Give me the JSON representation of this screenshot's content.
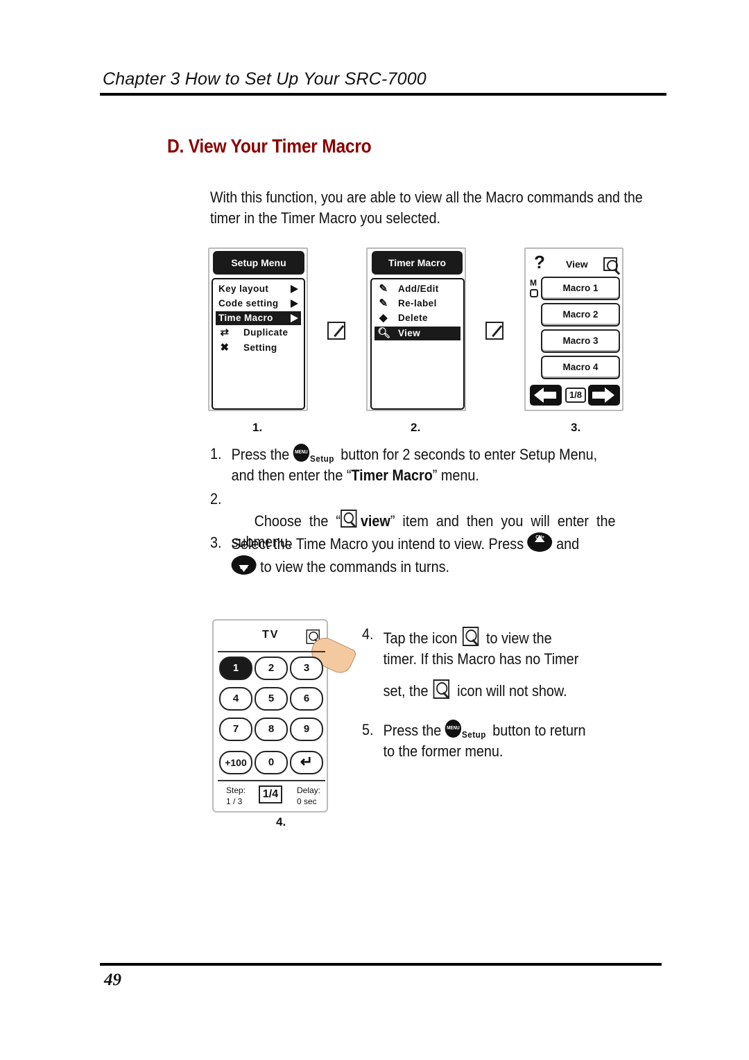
{
  "header": {
    "chapter_title": "Chapter 3  How to Set Up Your SRC-7000"
  },
  "section": {
    "title": "D.  View Your Timer Macro",
    "intro": "With this function, you are able to view all the Macro commands and the timer in the Timer Macro you selected."
  },
  "figures": {
    "setup_menu": {
      "title": "Setup Menu",
      "items": [
        {
          "label": "Key layout",
          "arrow": true
        },
        {
          "label": "Code setting",
          "arrow": true
        },
        {
          "label": "Time  Macro",
          "arrow": true,
          "selected": true
        },
        {
          "label": "Duplicate",
          "icon": "duplicate-icon"
        },
        {
          "label": "Setting",
          "icon": "tools-icon"
        }
      ],
      "caption": "1."
    },
    "timer_macro": {
      "title": "Timer Macro",
      "items": [
        {
          "label": "Add/Edit",
          "icon": "add-edit-icon"
        },
        {
          "label": "Re-label",
          "icon": "relabel-icon"
        },
        {
          "label": "Delete",
          "icon": "delete-icon"
        },
        {
          "label": "View",
          "icon": "view-icon",
          "selected": true
        }
      ],
      "caption": "2."
    },
    "view_screen": {
      "help": "?",
      "title": "View",
      "side_label": "M",
      "macros": [
        "Macro 1",
        "Macro 2",
        "Macro 3",
        "Macro 4"
      ],
      "page": "1/8",
      "caption": "3."
    },
    "keypad_screen": {
      "device": "TV",
      "keys": [
        "1",
        "2",
        "3",
        "4",
        "5",
        "6",
        "7",
        "8",
        "9",
        "+100",
        "0",
        "enter"
      ],
      "selected_key": "1",
      "step_label": "Step:",
      "step_value": "1 / 3",
      "page": "1/4",
      "delay_label": "Delay:",
      "delay_value": "0 sec",
      "caption": "4."
    }
  },
  "menu_button": {
    "circle_text": "MENU",
    "label": "Setup"
  },
  "ch_up": {
    "text": "CH+"
  },
  "ch_down": {
    "text": "CH-"
  },
  "steps": {
    "s1": {
      "num": "1.",
      "a": "Press the",
      "b": "button for 2 seconds to enter Setup Menu,",
      "c": "and then enter the “",
      "bold": "Timer Macro",
      "d": "” menu."
    },
    "s2": {
      "num": "2.",
      "a": "Choose  the  “",
      "bold": "view",
      "b": "”  item  and  then  you  will  enter  the",
      "c": "submenu."
    },
    "s3": {
      "num": "3.",
      "a": "Select the Time Macro you intend to view. Press",
      "b": "and",
      "c": "to view the commands in turns."
    },
    "s4": {
      "num": "4.",
      "a": "Tap  the  icon",
      "b": "to  view  the",
      "c": "timer. If this Macro has no Timer",
      "d": "set, the",
      "e": "icon will not show."
    },
    "s5": {
      "num": "5.",
      "a": "Press the",
      "b": "button to return",
      "c": "to the former menu."
    }
  },
  "footer": {
    "page_number": "49"
  }
}
